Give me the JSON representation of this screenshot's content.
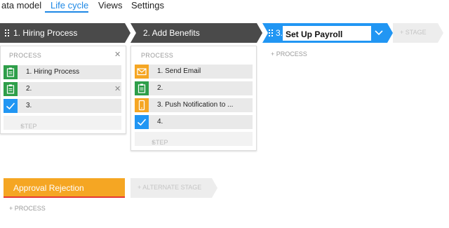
{
  "tabs": [
    {
      "label": "ata model"
    },
    {
      "label": "Life cycle",
      "active": true
    },
    {
      "label": "Views"
    },
    {
      "label": "Settings"
    }
  ],
  "stages": [
    {
      "label": "1.  Hiring Process",
      "color": "#4a4a4a"
    },
    {
      "label": "2.  Add Benefits",
      "color": "#4a4a4a"
    },
    {
      "number": "3.",
      "value": "Set Up Payroll",
      "color": "#2196f3"
    }
  ],
  "add_stage_label": "STAGE",
  "card1": {
    "header": "PROCESS",
    "steps": [
      {
        "label": "1.  Hiring Process",
        "icon": "clipboard-icon"
      },
      {
        "label": "2.",
        "icon": "clipboard-icon"
      },
      {
        "label": "3.",
        "icon": "checkmark-icon"
      }
    ],
    "add_step": "STEP"
  },
  "card2": {
    "header": "PROCESS",
    "steps": [
      {
        "label": "1.  Send Email",
        "icon": "envelope-icon"
      },
      {
        "label": "2.",
        "icon": "clipboard-icon"
      },
      {
        "label": "3.  Push Notification to ...",
        "icon": "mobile-phone-icon"
      },
      {
        "label": "4.",
        "icon": "checkmark-icon"
      }
    ],
    "add_step": "STEP"
  },
  "stage3_add_process": "PROCESS",
  "alternate": {
    "stage_label": "Approval Rejection",
    "add_alternate_label": "ALTERNATE STAGE",
    "add_process": "PROCESS"
  },
  "colors": {
    "green": "#2e9e49",
    "orange": "#f5a623",
    "blue": "#2196f3",
    "dark": "#4a4a4a",
    "red": "#e53935"
  }
}
